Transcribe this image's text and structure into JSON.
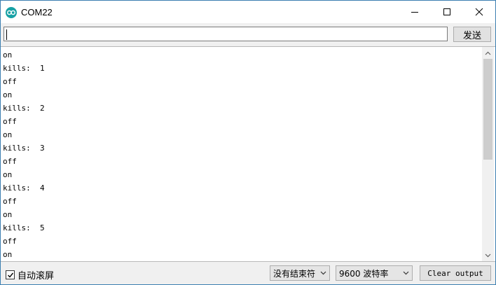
{
  "window": {
    "title": "COM22"
  },
  "send": {
    "input_value": "",
    "button_label": "发送"
  },
  "output": {
    "lines": [
      "on",
      "kills:  1",
      "off",
      "on",
      "kills:  2",
      "off",
      "on",
      "kills:  3",
      "off",
      "on",
      "kills:  4",
      "off",
      "on",
      "kills:  5",
      "off",
      "on"
    ]
  },
  "footer": {
    "autoscroll_label": "自动滚屏",
    "autoscroll_checked": true,
    "line_ending_selected": "没有结束符",
    "baud_rate_selected": "9600 波特率",
    "clear_button_label": "Clear output"
  },
  "colors": {
    "app_icon": "#17a1a5",
    "window_border": "#3c7fb1"
  },
  "icons": {
    "app": "arduino-infinity-icon",
    "minimize": "minimize-icon",
    "maximize": "maximize-icon",
    "close": "close-icon",
    "dropdown": "chevron-down-icon",
    "check": "checkmark-icon"
  }
}
